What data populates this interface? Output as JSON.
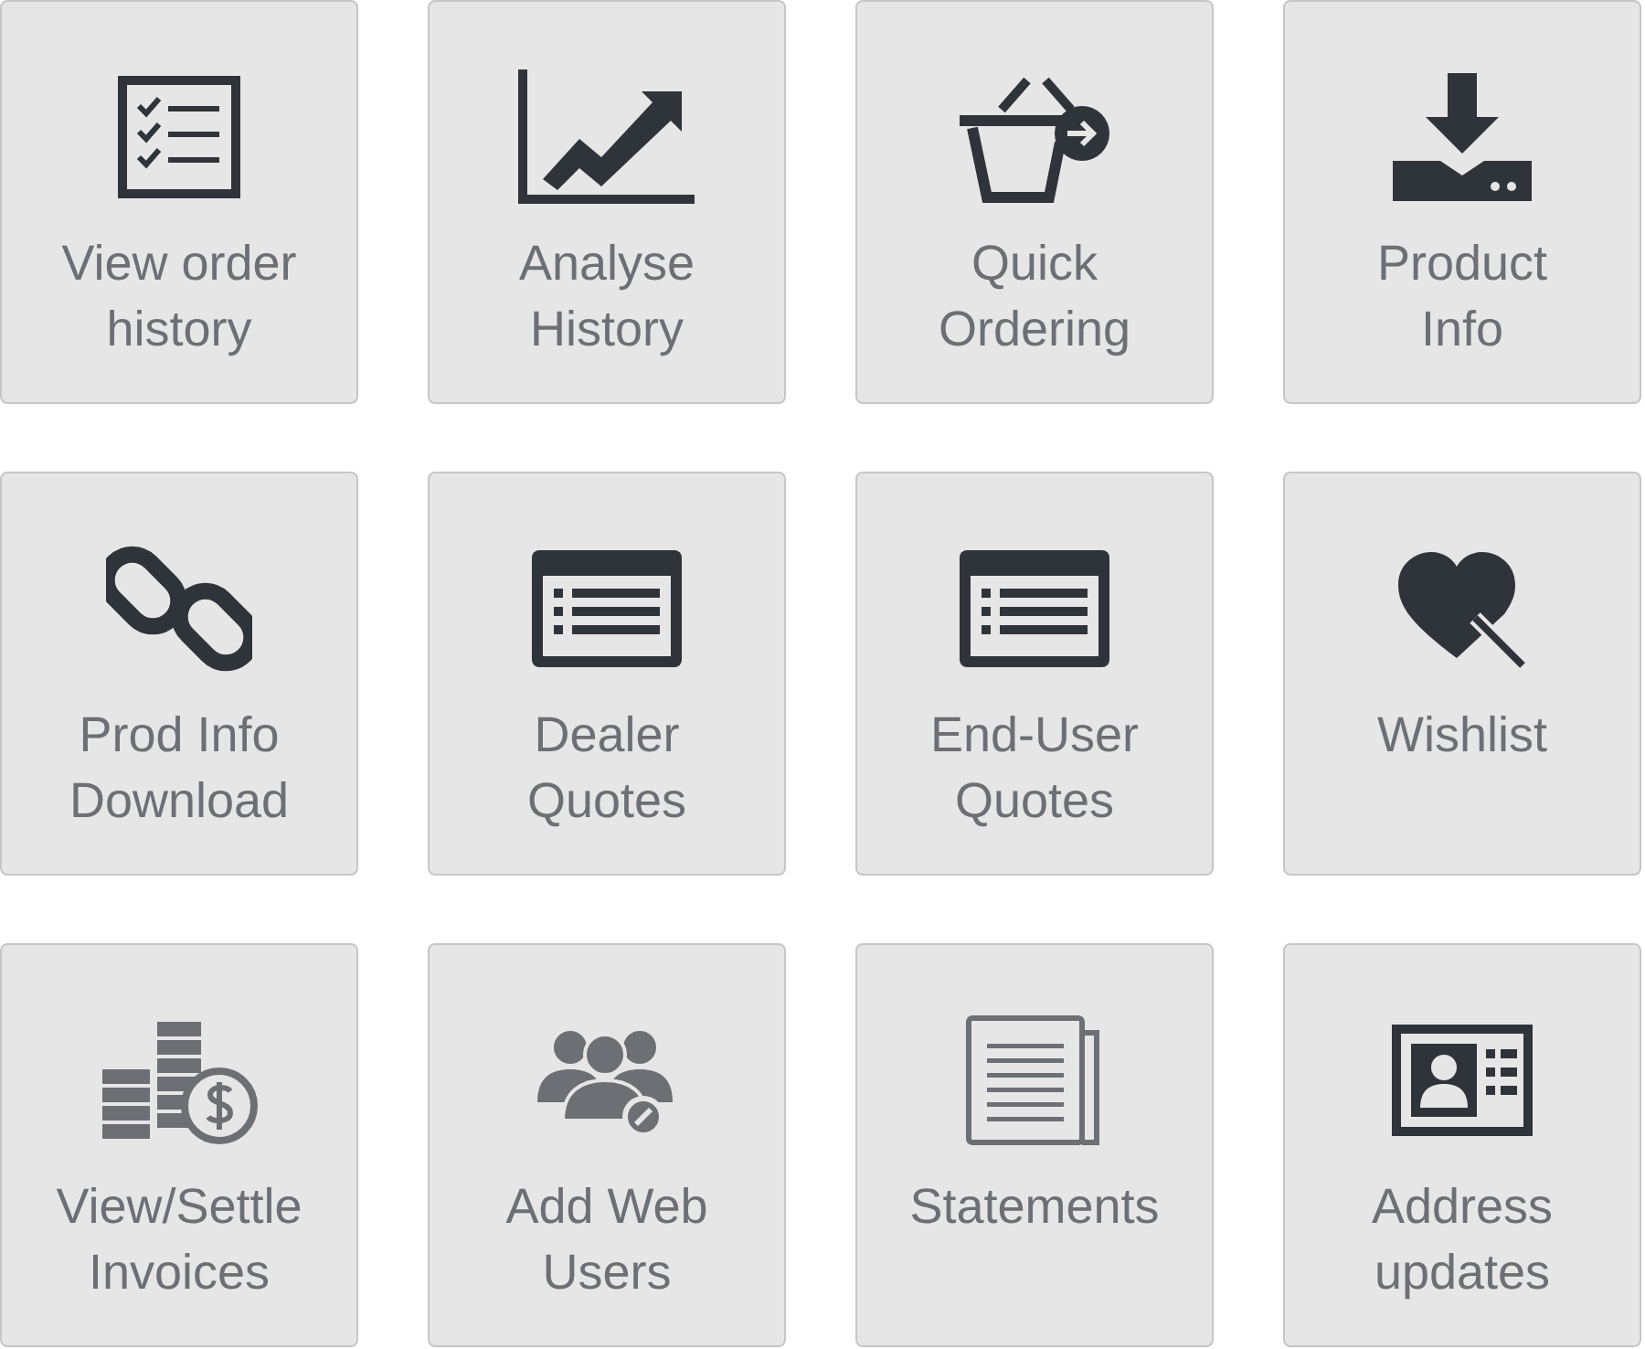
{
  "tiles": [
    {
      "kind": "checklist",
      "label_lines": [
        "View order",
        "history"
      ]
    },
    {
      "kind": "chart",
      "label_lines": [
        "Analyse",
        "History"
      ]
    },
    {
      "kind": "basket",
      "label_lines": [
        "Quick",
        "Ordering"
      ]
    },
    {
      "kind": "download",
      "label_lines": [
        "Product",
        "Info"
      ]
    },
    {
      "kind": "link",
      "label_lines": [
        "Prod Info",
        "Download"
      ]
    },
    {
      "kind": "list-window",
      "label_lines": [
        "Dealer",
        "Quotes"
      ]
    },
    {
      "kind": "list-window",
      "label_lines": [
        "End-User",
        "Quotes"
      ]
    },
    {
      "kind": "heart",
      "label_lines": [
        "Wishlist"
      ]
    },
    {
      "kind": "coins",
      "label_lines": [
        "View/Settle",
        "Invoices"
      ]
    },
    {
      "kind": "users",
      "label_lines": [
        "Add Web",
        "Users"
      ]
    },
    {
      "kind": "document",
      "label_lines": [
        "Statements"
      ]
    },
    {
      "kind": "id-card",
      "label_lines": [
        "Address",
        "updates"
      ]
    }
  ]
}
